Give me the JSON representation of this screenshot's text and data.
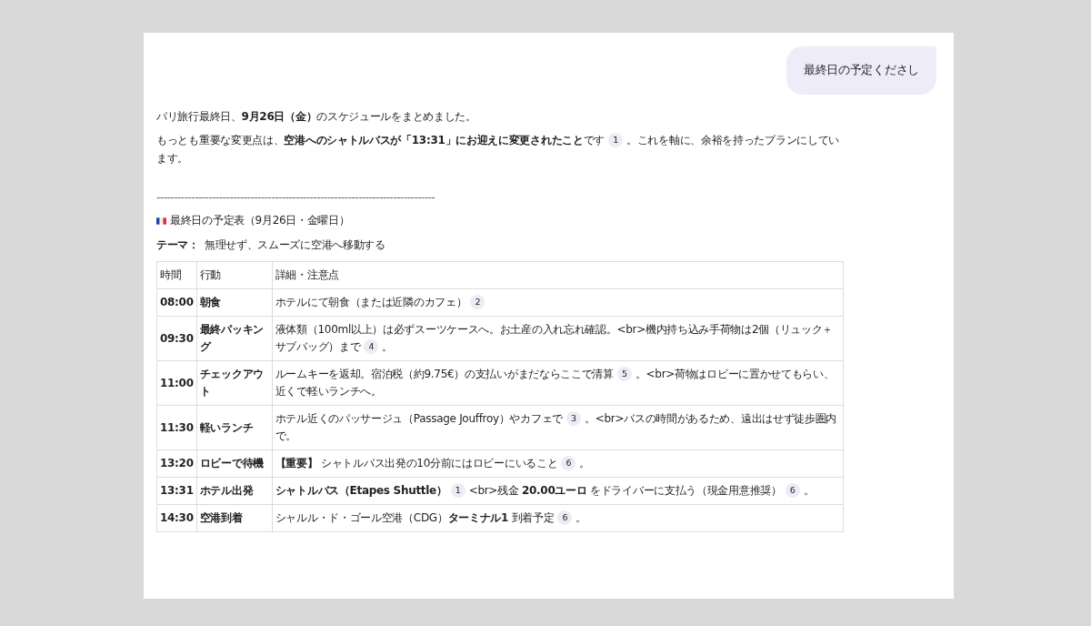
{
  "user_message": "最終日の予定くださし",
  "intro": [
    [
      {
        "kind": "text",
        "text": "パリ旅行最終日、**9月26日（金）**のスケジュールをまとめました。"
      }
    ],
    [
      {
        "kind": "text",
        "text": "もっとも重要な変更点は、**空港へのシャトルバスが「13:31」にお迎えに変更されたこと**です"
      },
      {
        "kind": "cite",
        "text": "1"
      },
      {
        "kind": "text",
        "text": "。これを軸に、余裕を持ったプランにしています。"
      }
    ]
  ],
  "divider_text": "--------------------------------------------------------------------------------",
  "schedule_title": "最終日の予定表（9月26日・金曜日）",
  "theme": {
    "label": "テーマ：",
    "text": "無理せず、スムーズに空港へ移動する"
  },
  "table": {
    "columns": [
      "時間",
      "行動",
      "詳細・注意点"
    ],
    "rows": [
      {
        "time": "08:00",
        "action": "朝食",
        "details": [
          {
            "kind": "text",
            "text": "ホテルにて朝食（または近隣のカフェ）"
          },
          {
            "kind": "cite",
            "text": "2"
          }
        ]
      },
      {
        "time": "09:30",
        "action": "最終パッキング",
        "details": [
          {
            "kind": "text",
            "text": "液体類（100ml以上）は必ずスーツケースへ。お土産の入れ忘れ確認。<br>機内持ち込み手荷物は2個（リュック＋サブバッグ）まで"
          },
          {
            "kind": "cite",
            "text": "4"
          },
          {
            "kind": "text",
            "text": "。"
          }
        ]
      },
      {
        "time": "11:00",
        "action": "チェックアウト",
        "details": [
          {
            "kind": "text",
            "text": "ルームキーを返却。宿泊税（約9.75€）の支払いがまだならここで清算"
          },
          {
            "kind": "cite",
            "text": "5"
          },
          {
            "kind": "text",
            "text": "。<br>荷物はロビーに置かせてもらい、近くで軽いランチへ。"
          }
        ]
      },
      {
        "time": "11:30",
        "action": "軽いランチ",
        "details": [
          {
            "kind": "text",
            "text": "ホテル近くのパッサージュ（Passage Jouffroy）やカフェで"
          },
          {
            "kind": "cite",
            "text": "3"
          },
          {
            "kind": "text",
            "text": "。<br>バスの時間があるため、遠出はせず徒歩圏内で。"
          }
        ]
      },
      {
        "time": "13:20",
        "action": "ロビーで待機",
        "details": [
          {
            "kind": "text",
            "text": "**【重要】** シャトルバス出発の10分前にはロビーにいること"
          },
          {
            "kind": "cite",
            "text": "6"
          },
          {
            "kind": "text",
            "text": "。"
          }
        ]
      },
      {
        "time": "13:31",
        "action": "ホテル出発",
        "details": [
          {
            "kind": "text",
            "text": "**シャトルバス（Etapes Shuttle）**"
          },
          {
            "kind": "cite",
            "text": "1"
          },
          {
            "kind": "text",
            "text": "<br>残金 **20.00ユーロ** をドライバーに支払う（現金用意推奨）"
          },
          {
            "kind": "cite",
            "text": "6"
          },
          {
            "kind": "text",
            "text": "。"
          }
        ]
      },
      {
        "time": "14:30",
        "action": "空港到着",
        "details": [
          {
            "kind": "text",
            "text": "シャルル・ド・ゴール空港（CDG）**ターミナル1** 到着予定"
          },
          {
            "kind": "cite",
            "text": "6"
          },
          {
            "kind": "text",
            "text": "。"
          }
        ]
      }
    ]
  }
}
